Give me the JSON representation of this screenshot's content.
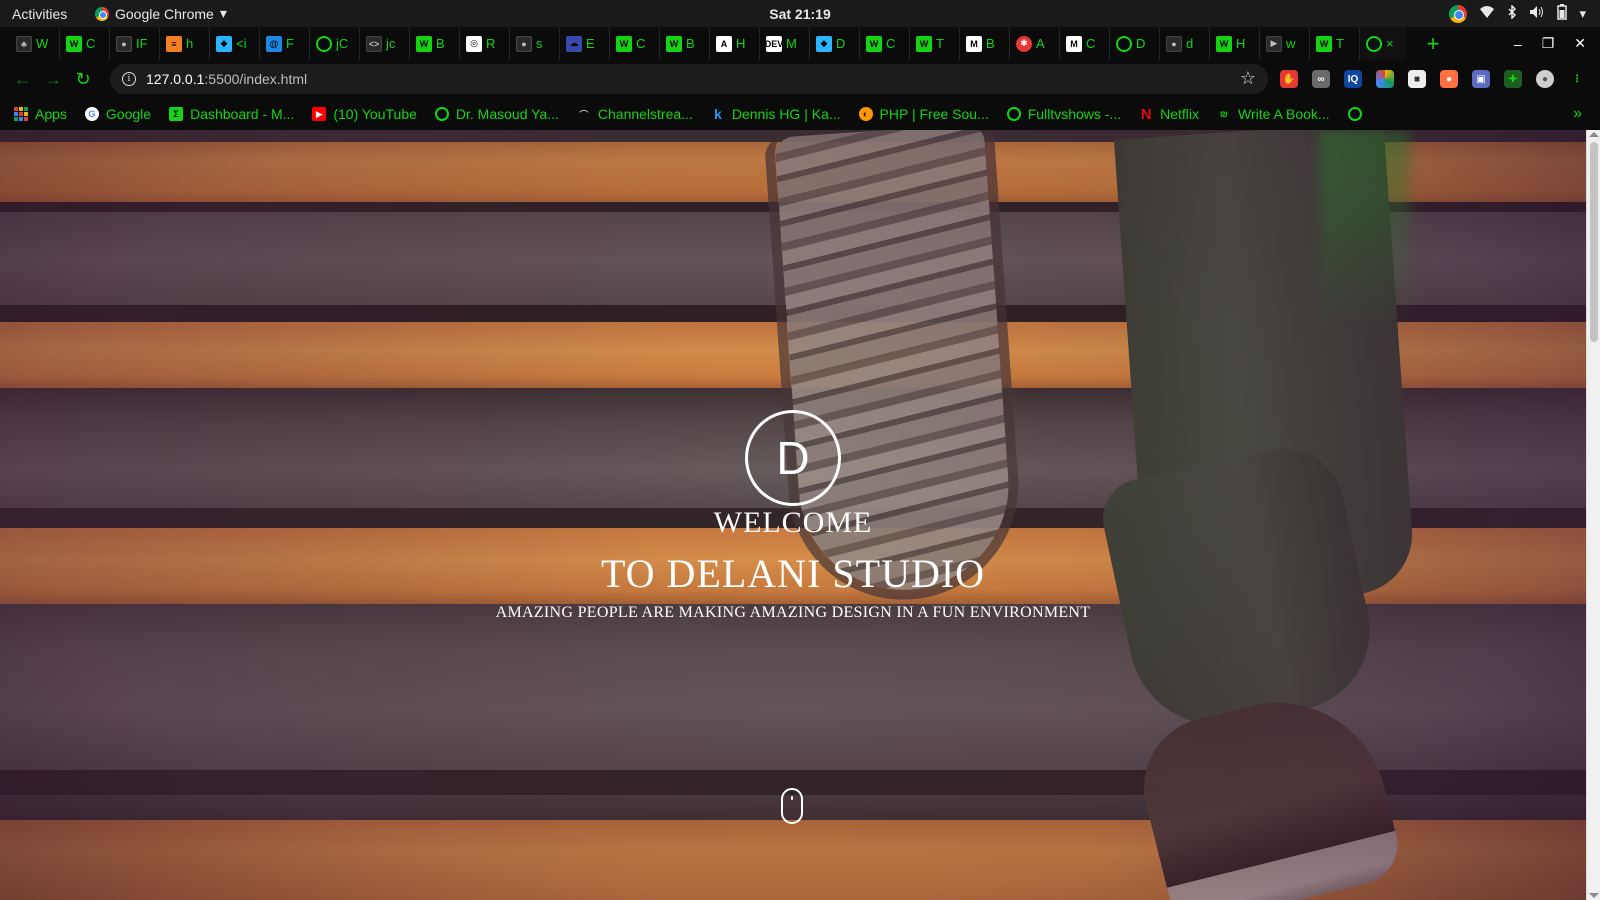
{
  "system_bar": {
    "activities": "Activities",
    "app_name": "Google Chrome",
    "clock": "Sat 21:19"
  },
  "browser": {
    "tabs": [
      {
        "title": "W",
        "icon": "leaf-icon"
      },
      {
        "title": "C",
        "icon": "dev-badge-icon"
      },
      {
        "title": "IF",
        "icon": "github-icon"
      },
      {
        "title": "h",
        "icon": "stackoverflow-icon"
      },
      {
        "title": "<i",
        "icon": "codepen-icon"
      },
      {
        "title": "F",
        "icon": "swirl-icon"
      },
      {
        "title": "jC",
        "icon": "ring-icon"
      },
      {
        "title": "jc",
        "icon": "code-brackets-icon"
      },
      {
        "title": "B",
        "icon": "dev-badge-icon"
      },
      {
        "title": "R",
        "icon": "gear-ring-icon"
      },
      {
        "title": "s",
        "icon": "github-icon"
      },
      {
        "title": "E",
        "icon": "cloud-icon"
      },
      {
        "title": "C",
        "icon": "dev-badge-icon"
      },
      {
        "title": "B",
        "icon": "dev-badge-icon"
      },
      {
        "title": "H",
        "icon": "angular-icon"
      },
      {
        "title": "M",
        "icon": "dev-to-icon"
      },
      {
        "title": "D",
        "icon": "codepen-icon"
      },
      {
        "title": "C",
        "icon": "dev-badge-icon"
      },
      {
        "title": "T",
        "icon": "dev-badge-icon"
      },
      {
        "title": "B",
        "icon": "medium-icon"
      },
      {
        "title": "A",
        "icon": "red-badge-icon"
      },
      {
        "title": "C",
        "icon": "medium-icon"
      },
      {
        "title": "D",
        "icon": "ring-icon"
      },
      {
        "title": "d",
        "icon": "github-icon"
      },
      {
        "title": "H",
        "icon": "dev-badge-icon"
      },
      {
        "title": "w",
        "icon": "video-icon"
      },
      {
        "title": "T",
        "icon": "dev-badge-icon"
      }
    ],
    "active_tab_close": "×",
    "new_tab": "+",
    "window_controls": {
      "minimize": "–",
      "restore": "❐",
      "close": "✕"
    },
    "url": {
      "host": "127.0.0.1",
      "rest": ":5500/index.html"
    },
    "bookmarks": [
      {
        "label": "Apps",
        "icon": "apps-grid-icon"
      },
      {
        "label": "Google",
        "icon": "google-icon"
      },
      {
        "label": "Dashboard - M...",
        "icon": "dashboard-icon"
      },
      {
        "label": "(10) YouTube",
        "icon": "youtube-icon"
      },
      {
        "label": "Dr. Masoud Ya...",
        "icon": "ring-icon"
      },
      {
        "label": "Channelstrea...",
        "icon": "hat-icon"
      },
      {
        "label": "Dennis HG | Ka...",
        "icon": "k-icon"
      },
      {
        "label": "PHP | Free Sou...",
        "icon": "php-icon"
      },
      {
        "label": "Fulltvshows -...",
        "icon": "ring-icon"
      },
      {
        "label": "Netflix",
        "icon": "netflix-icon"
      },
      {
        "label": "Write A Book...",
        "icon": "book-icon"
      }
    ],
    "bookmarks_more": "»",
    "accent_color": "#14d414"
  },
  "page": {
    "logo_letter": "D",
    "welcome": "WELCOME",
    "title": "TO DELANI STUDIO",
    "tagline": "AMAZING PEOPLE ARE MAKING AMAZING DESIGN IN A FUN ENVIRONMENT"
  }
}
